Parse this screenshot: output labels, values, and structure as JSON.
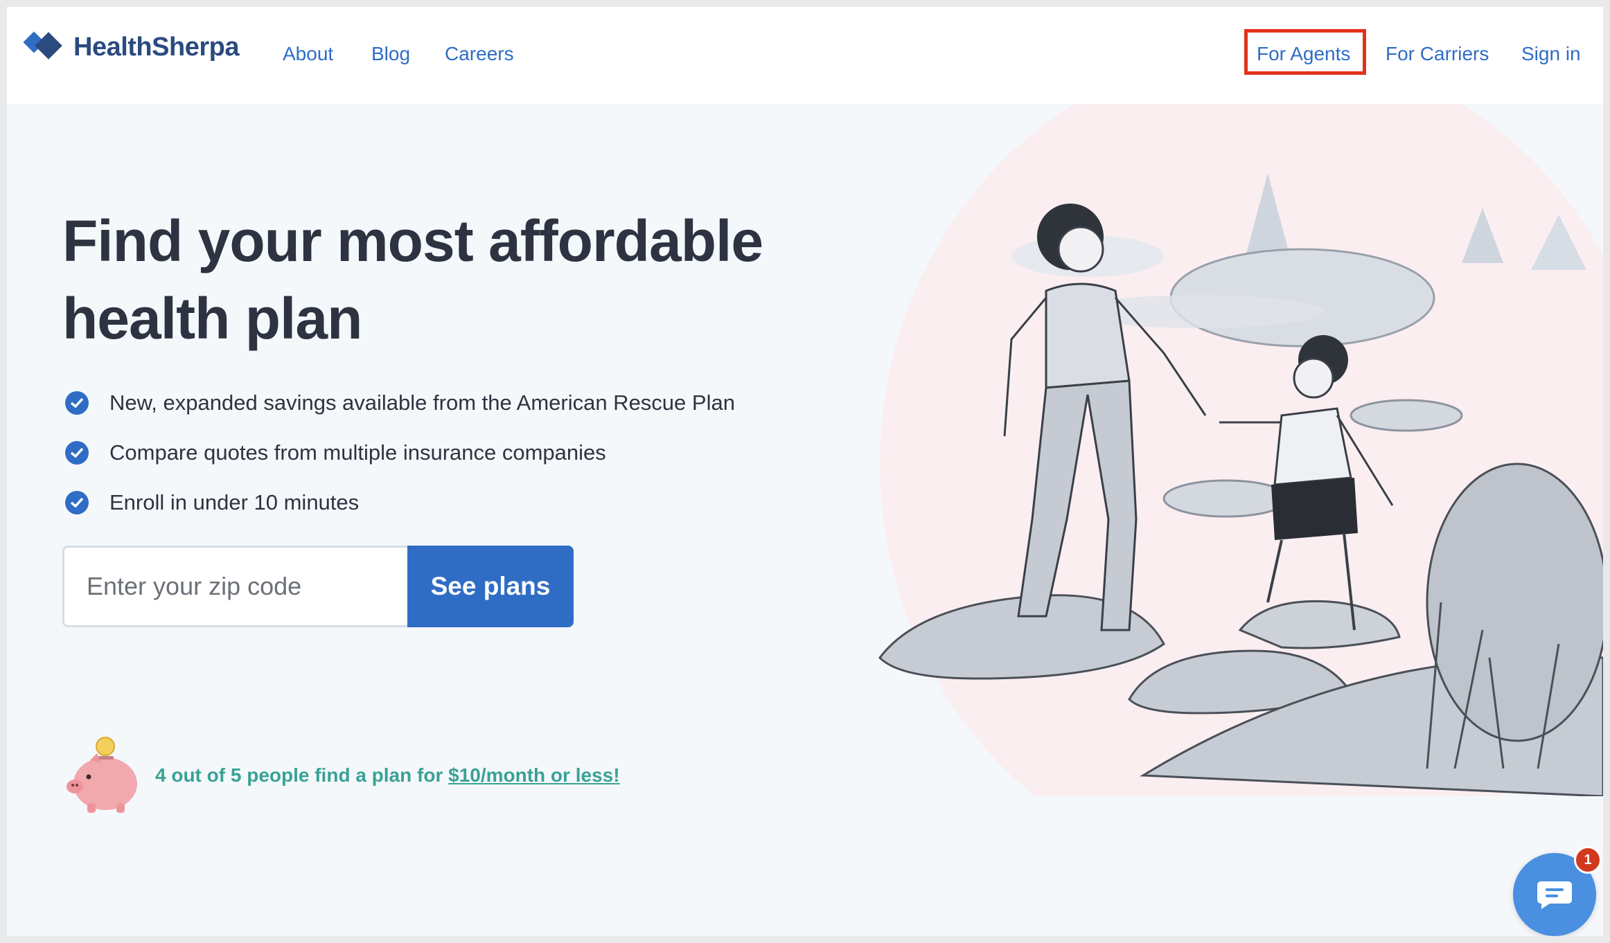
{
  "brand": {
    "name": "HealthSherpa",
    "logo_icon": "healthsherpa-diamond-logo",
    "color": "#2b4a80"
  },
  "nav": {
    "about": "About",
    "blog": "Blog",
    "careers": "Careers",
    "for_agents": "For Agents",
    "for_carriers": "For Carriers",
    "sign_in": "Sign in",
    "link_color": "#2f6dc5",
    "highlight_color": "#e2321b"
  },
  "hero": {
    "title": "Find your most affordable health plan",
    "benefits": [
      "New, expanded savings available from the American Rescue Plan",
      "Compare quotes from multiple insurance companies",
      "Enroll in under 10 minutes"
    ],
    "zip_placeholder": "Enter your zip code",
    "zip_value": "",
    "cta_label": "See plans",
    "cta_color": "#2f6dc5"
  },
  "promo": {
    "icon": "piggy-bank-icon",
    "text": "4 out of 5 people find a plan for ",
    "link_text": "$10/month or less!",
    "text_color": "#39a295"
  },
  "chat": {
    "icon": "chat-bubble-icon",
    "badge_count": "1",
    "badge_color": "#d23a1e"
  }
}
